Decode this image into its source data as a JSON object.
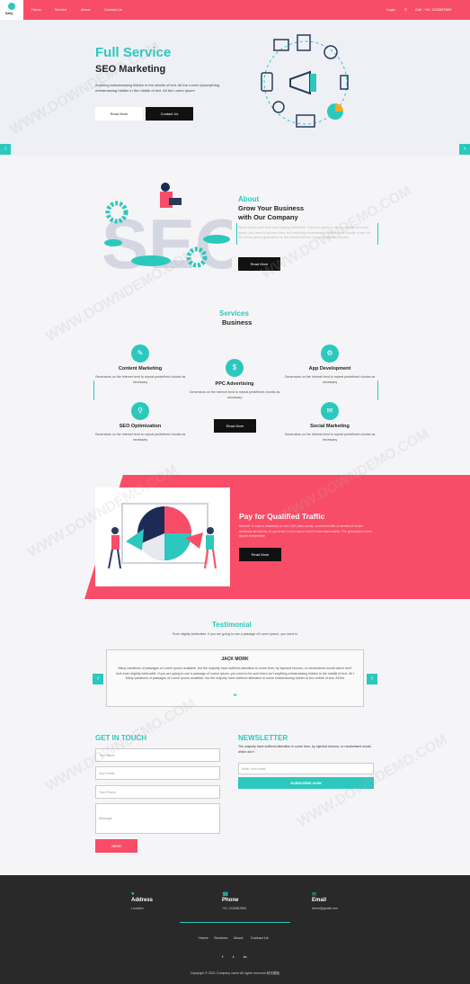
{
  "nav": {
    "logo_text": "Daily",
    "links": [
      "Home",
      "Service",
      "About",
      "Contact Us"
    ],
    "login": "Login",
    "search_icon": "search-icon",
    "phone": "Call : +91 1234567890"
  },
  "hero": {
    "title_line1": "Full Service",
    "title_line2": "SEO Marketing",
    "text": "Anything embarrassing hidden in the middle of text. All the Lorem Ipsumything embarrassing hidden in the middle of text. All the Lorem Ipsum",
    "btn_read": "Read More",
    "btn_contact": "Contact Us"
  },
  "about": {
    "sub": "About",
    "title_line1": "Grow Your Business",
    "title_line2": "with Our Company",
    "text": "Words which don't look even slightly believable. If you are going to use a passage of Lorem Ipsum, you need to be sure there isn't anything embarrassing hidden in the middle of text. All the Lorem Ipsum generators on the Internet tend to repeat predefined chunks",
    "btn": "Read More",
    "seo_letters": "SEO"
  },
  "services": {
    "sub": "Services",
    "title": "Business",
    "items": [
      {
        "title": "Content Marketing",
        "text": "Generators on the Internet tend to repeat predefined chunks as necessary"
      },
      {
        "title": "PPC Advertising",
        "text": "Generators on the Internet tend to repeat predefined chunks as necessary"
      },
      {
        "title": "App Development",
        "text": "Generators on the Internet tend to repeat predefined chunks as necessary"
      },
      {
        "title": "SEO Optimization",
        "text": "Generators on the Internet tend to repeat predefined chunks as necessary"
      },
      {
        "title": "Social Marketing",
        "text": "Generators on the Internet tend to repeat predefined chunks as necessary"
      }
    ],
    "btn": "Read More"
  },
  "traffic": {
    "title": "Pay for Qualified Traffic",
    "text": "Internet. It uses a dictionary of over 200 Latin words, combined with a handful of model sentence structures, to generate Lorem Ipsum which looks reasonable. The generated Lorem Ipsum is therefore",
    "btn": "Read More"
  },
  "testimonial": {
    "sub": "Testimonial",
    "intro": "Even slightly believable. If you are going to use a passage of Lorem Ipsum, you need to",
    "name": "JACK MORK",
    "text": "Many variations of passages of Lorem Ipsum available, but the majority have suffered alteration in some form, by injected humour, or randomised words which don't look even slightly believable. If you are going to use a passage of Lorem Ipsum, you need to be sure there isn't anything embarrassing hidden in the middle of text. All t Many variations of passages of Lorem Ipsum available, but the majority have suffered alteration in some embarrassing hidden in the middle of text. All the",
    "quote": "❝"
  },
  "contact": {
    "title": "GET IN TOUCH",
    "name_ph": "Your Name",
    "email_ph": "Your Email",
    "phone_ph": "Your Phone",
    "message_ph": "Message",
    "send": "SEND"
  },
  "newsletter": {
    "title": "NEWSLETTER",
    "text": "The majority have suffered alteration in some form, by injected humour, or randomised words which don't",
    "email_ph": "Enter Your email",
    "btn": "SUBSCRIBE NOW"
  },
  "footer": {
    "address_label": "Address",
    "address_value": "Location",
    "phone_label": "Phone",
    "phone_value": "+01 1234567890",
    "email_label": "Email",
    "email_value": "demo@gmail.com",
    "links": [
      "Home",
      "Services",
      "About",
      "Contact Us"
    ],
    "social": [
      "f",
      "t",
      "in"
    ],
    "copyright": "Copyright © 2021 Company name All rights reserved.网页模板"
  },
  "watermark": "WWW.DOWNDEMO.COM",
  "colors": {
    "accent": "#2cc8bd",
    "brand": "#f84d68",
    "dark": "#292929"
  }
}
